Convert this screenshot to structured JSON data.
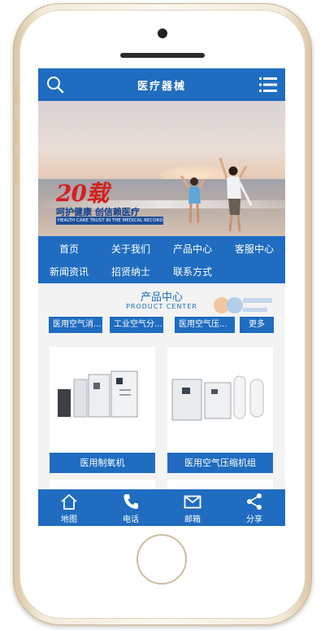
{
  "header": {
    "title": "医疗器械"
  },
  "banner": {
    "years": "20载",
    "slogan": "呵护健康  创信赖医疗",
    "slogan_en": "HEALTH CARE TRUST IN THE MEDICAL RECORD",
    "slide_count": 2,
    "active_slide": 1
  },
  "nav": {
    "items": [
      {
        "label": "首页"
      },
      {
        "label": "关于我们"
      },
      {
        "label": "产品中心"
      },
      {
        "label": "客服中心"
      },
      {
        "label": "新闻资讯"
      },
      {
        "label": "招贤纳士"
      },
      {
        "label": "联系方式"
      }
    ]
  },
  "products_section": {
    "title": "产品中心",
    "subtitle": "PRODUCT CENTER",
    "categories": [
      {
        "label": "医用空气消..."
      },
      {
        "label": "工业空气分..."
      },
      {
        "label": "医用空气压..."
      }
    ],
    "more_label": "更多",
    "items": [
      {
        "label": "医用制氧机"
      },
      {
        "label": "医用空气压缩机组"
      }
    ]
  },
  "bottom_bar": {
    "items": [
      {
        "label": "地图",
        "icon": "home-icon"
      },
      {
        "label": "电话",
        "icon": "phone-icon"
      },
      {
        "label": "邮箱",
        "icon": "mail-icon"
      },
      {
        "label": "分享",
        "icon": "share-icon"
      }
    ]
  },
  "colors": {
    "primary": "#1f6cc0",
    "accent_red": "#d41f1f"
  }
}
